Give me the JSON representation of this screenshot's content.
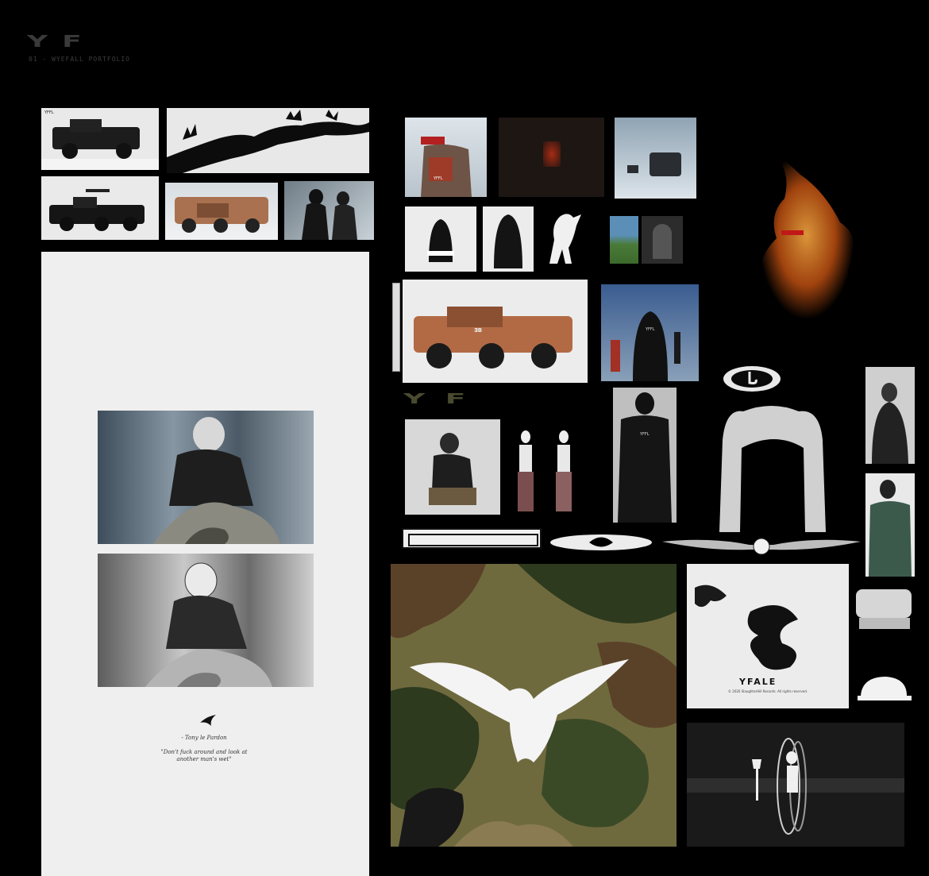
{
  "header": {
    "logo": "YF",
    "subtitle": "01 - WYEFALL PORTFOLIO"
  },
  "tiles": {
    "truck_poster_1_tag": "YFFL",
    "jacket_tag": "YFFL",
    "hoodie_tag": "YFFL",
    "hood_figure_tag": "YFFL",
    "mark_yf": "YF",
    "wheel_badge": "ƎB",
    "poster_quote_author": "- Tony le Pardon",
    "poster_quote": "\"Don't fuck around and look at another man's wet\"",
    "dragon_title": "YFALE",
    "dragon_copy": "© 2020 SlaughterHill Records. All rights reserved."
  },
  "colors": {
    "background": "#000000",
    "poster_bg": "#efefef",
    "camo_light": "#6f6a3e",
    "camo_dark": "#2d3a1e",
    "camo_brown": "#5a4228",
    "fire": "#e0721a"
  }
}
